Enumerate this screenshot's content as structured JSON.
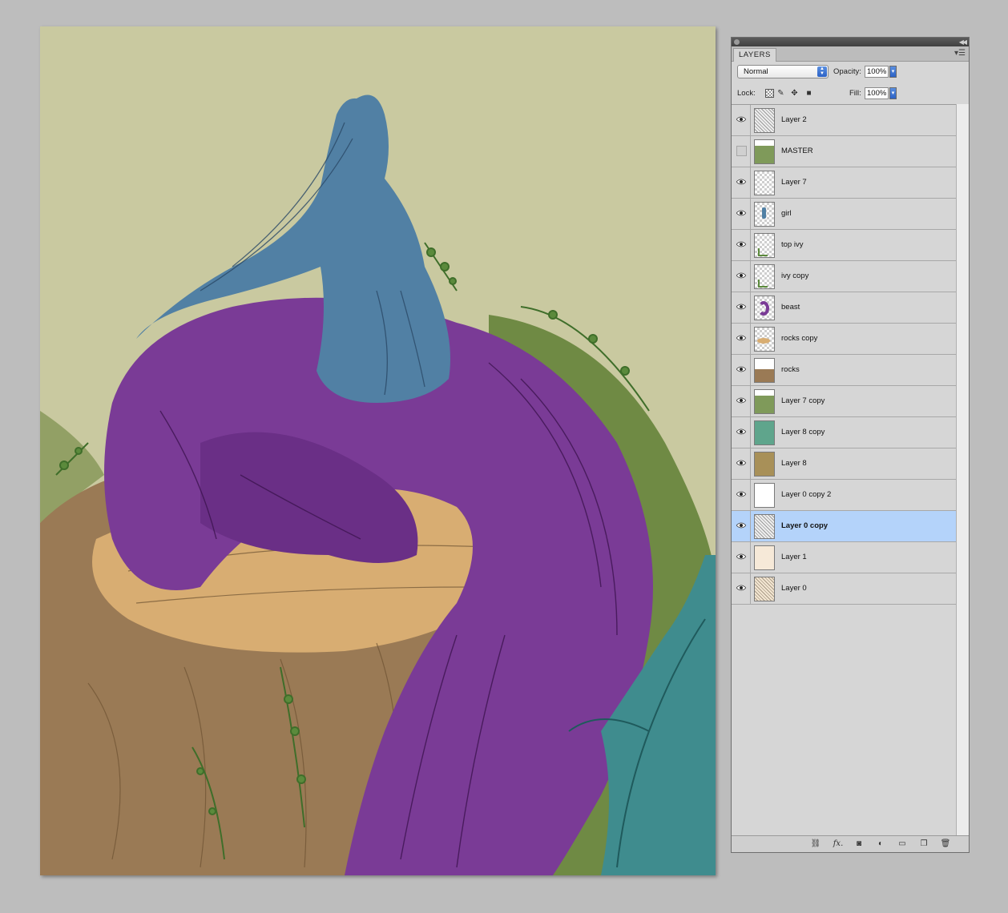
{
  "panel": {
    "tab_label": "LAYERS",
    "blend_mode": "Normal",
    "opacity_label": "Opacity:",
    "opacity_value": "100%",
    "lock_label": "Lock:",
    "fill_label": "Fill:",
    "fill_value": "100%",
    "layers": [
      {
        "name": "Layer 2",
        "visible": true,
        "thumb": "sketch"
      },
      {
        "name": "MASTER",
        "visible": false,
        "thumb": "hill-green"
      },
      {
        "name": "Layer 7",
        "visible": true,
        "thumb": "transparent"
      },
      {
        "name": "girl",
        "visible": true,
        "thumb": "girl"
      },
      {
        "name": "top ivy",
        "visible": true,
        "thumb": "ivy"
      },
      {
        "name": "ivy copy",
        "visible": true,
        "thumb": "ivy"
      },
      {
        "name": "beast",
        "visible": true,
        "thumb": "beast"
      },
      {
        "name": "rocks copy",
        "visible": true,
        "thumb": "rocks-copy"
      },
      {
        "name": "rocks",
        "visible": true,
        "thumb": "rocks"
      },
      {
        "name": "Layer 7 copy",
        "visible": true,
        "thumb": "hill-green"
      },
      {
        "name": "Layer 8 copy",
        "visible": true,
        "thumb": "fill-teal"
      },
      {
        "name": "Layer 8",
        "visible": true,
        "thumb": "fill-olive"
      },
      {
        "name": "Layer 0 copy 2",
        "visible": true,
        "thumb": "fill-white"
      },
      {
        "name": "Layer 0 copy",
        "visible": true,
        "thumb": "sketch",
        "selected": true
      },
      {
        "name": "Layer 1",
        "visible": true,
        "thumb": "fill-cream"
      },
      {
        "name": "Layer 0",
        "visible": true,
        "thumb": "sketch-cream"
      }
    ]
  },
  "colors": {
    "canvas_bg": "#c9c9a0",
    "selection": "#b4d3fa",
    "beast_purple": "#7a3b96",
    "girl_blue": "#5180a4",
    "rock_tan": "#c9a069",
    "ivy_green": "#5b8a3c",
    "teal_tree": "#3f8c8e"
  }
}
